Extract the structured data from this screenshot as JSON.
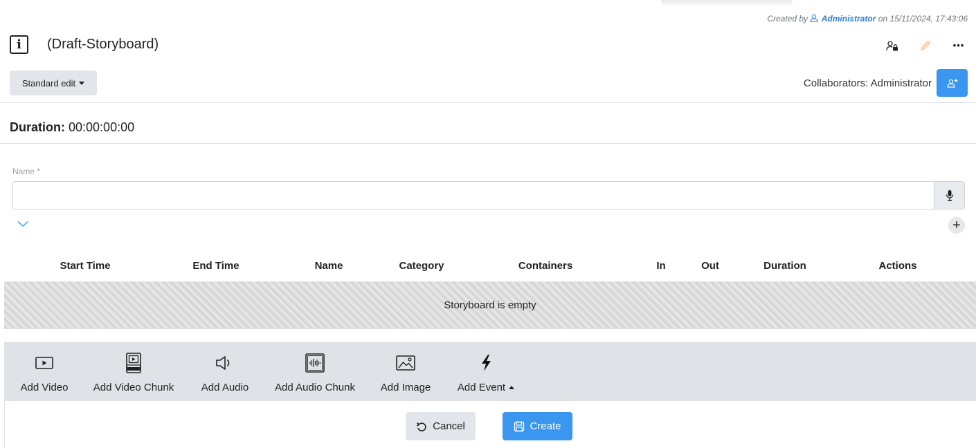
{
  "header": {
    "created_prefix": "Created by",
    "created_user": "Administrator",
    "created_suffix": "on 15/11/2024, 17:43:06",
    "title": "(Draft-Storyboard)",
    "info_glyph": "i",
    "more_glyph": "•••",
    "icons": [
      "info-icon",
      "user-lock-icon",
      "edit-disabled-icon",
      "more-icon"
    ]
  },
  "toolbar_top": {
    "edit_mode_label": "Standard edit",
    "collaborators_label": "Collaborators: Administrator"
  },
  "duration": {
    "label": "Duration:",
    "value": "00:00:00:00"
  },
  "form": {
    "name_label": "Name",
    "name_required_mark": "*",
    "name_value": "",
    "add_glyph": "+"
  },
  "table": {
    "columns": [
      "Start Time",
      "End Time",
      "Name",
      "Category",
      "Containers",
      "In",
      "Out",
      "Duration",
      "Actions"
    ],
    "empty_message": "Storyboard is empty"
  },
  "add_toolbar": {
    "items": [
      {
        "label": "Add Video",
        "icon": "video-icon"
      },
      {
        "label": "Add Video Chunk",
        "icon": "video-chunk-icon"
      },
      {
        "label": "Add Audio",
        "icon": "speaker-icon"
      },
      {
        "label": "Add Audio Chunk",
        "icon": "audio-chunk-icon"
      },
      {
        "label": "Add Image",
        "icon": "image-icon"
      },
      {
        "label": "Add Event",
        "icon": "bolt-icon"
      }
    ]
  },
  "footer": {
    "cancel_label": "Cancel",
    "create_label": "Create"
  },
  "colors": {
    "primary": "#3a96ee",
    "link": "#2d7fd9",
    "toolbar_bg": "#dfe2e6",
    "button_secondary": "#e2e5e9"
  }
}
